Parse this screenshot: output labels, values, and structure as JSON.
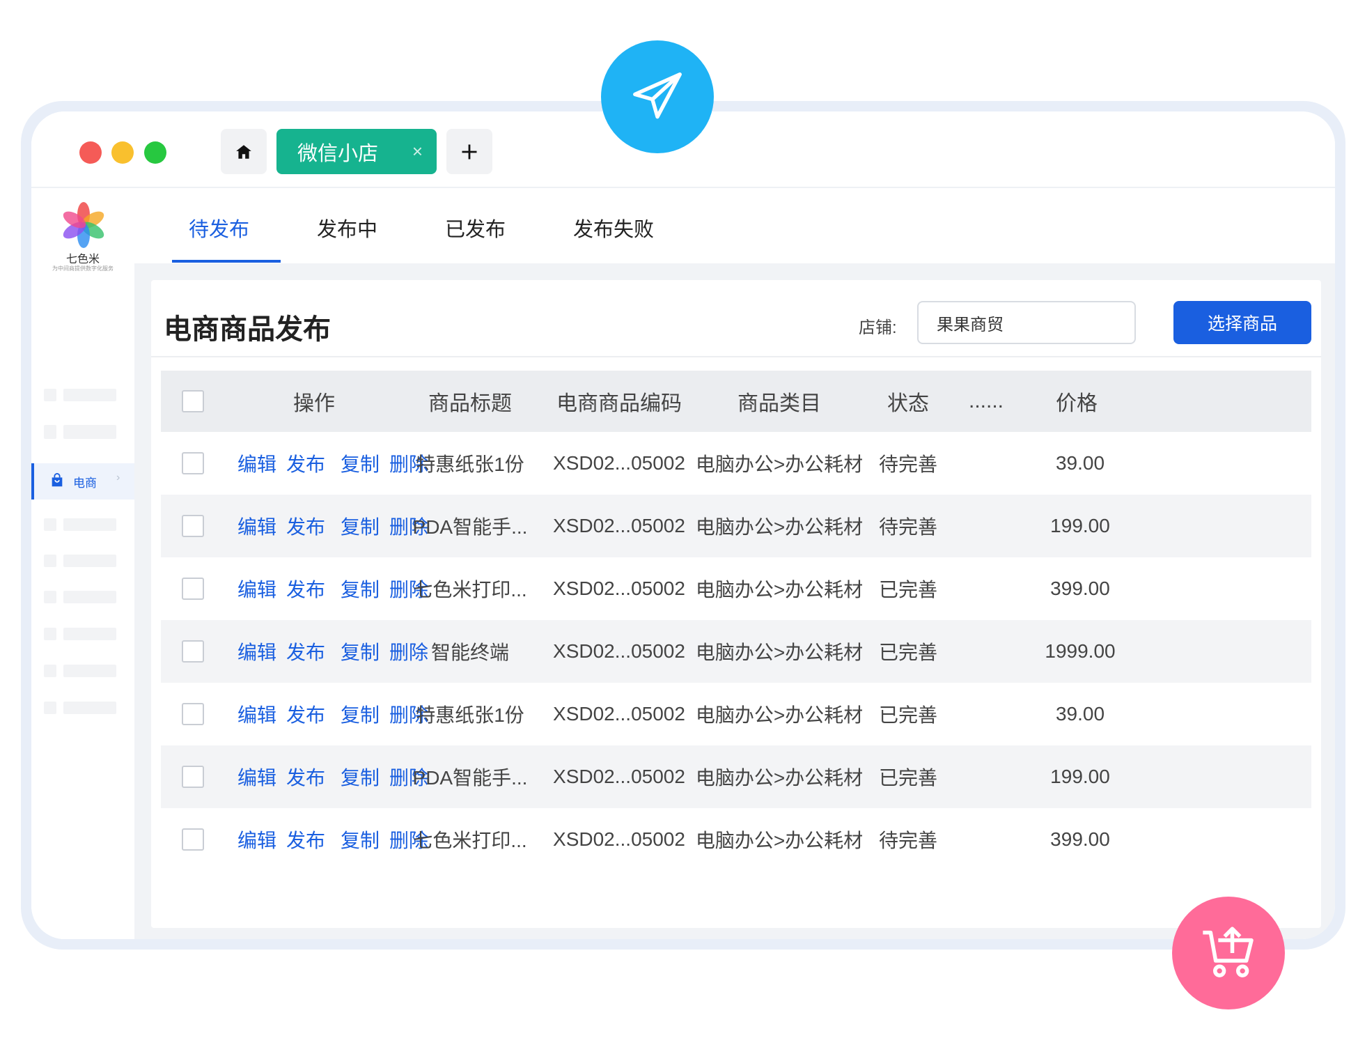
{
  "window": {
    "tabs": {
      "active_label": "微信小店",
      "close_glyph": "×",
      "add_glyph": "+"
    }
  },
  "sidebar": {
    "logo_name": "七色米",
    "logo_tagline": "为中间商提供数字化服务",
    "active_item": {
      "label": "电商",
      "icon": "shopping-bag-icon"
    }
  },
  "status_tabs": [
    {
      "label": "待发布",
      "active": true
    },
    {
      "label": "发布中",
      "active": false
    },
    {
      "label": "已发布",
      "active": false
    },
    {
      "label": "发布失败",
      "active": false
    }
  ],
  "page": {
    "title": "电商商品发布",
    "shop_label": "店铺:",
    "shop_value": "果果商贸",
    "select_button": "选择商品"
  },
  "table": {
    "headers": {
      "ops": "操作",
      "title": "商品标题",
      "code": "电商商品编码",
      "category": "商品类目",
      "status": "状态",
      "more": "......",
      "price": "价格"
    },
    "op_labels": [
      "编辑",
      "发布",
      "复制",
      "删除"
    ],
    "rows": [
      {
        "title": "特惠纸张1份",
        "code": "XSD02...05002",
        "category": "电脑办公>办公耗材",
        "status": "待完善",
        "price": "39.00"
      },
      {
        "title": "PDA智能手...",
        "code": "XSD02...05002",
        "category": "电脑办公>办公耗材",
        "status": "待完善",
        "price": "199.00"
      },
      {
        "title": "七色米打印...",
        "code": "XSD02...05002",
        "category": "电脑办公>办公耗材",
        "status": "已完善",
        "price": "399.00"
      },
      {
        "title": "智能终端",
        "code": "XSD02...05002",
        "category": "电脑办公>办公耗材",
        "status": "已完善",
        "price": "1999.00"
      },
      {
        "title": "特惠纸张1份",
        "code": "XSD02...05002",
        "category": "电脑办公>办公耗材",
        "status": "已完善",
        "price": "39.00"
      },
      {
        "title": "PDA智能手...",
        "code": "XSD02...05002",
        "category": "电脑办公>办公耗材",
        "status": "已完善",
        "price": "199.00"
      },
      {
        "title": "七色米打印...",
        "code": "XSD02...05002",
        "category": "电脑办公>办公耗材",
        "status": "待完善",
        "price": "399.00"
      }
    ]
  },
  "colors": {
    "accent": "#1a5fe0",
    "tab_active": "#16b38f",
    "send_badge": "#1fb3f5",
    "cart_badge": "#ff6b99"
  },
  "icons": {
    "home": "home-icon",
    "send": "paper-plane-icon",
    "cart": "cart-upload-icon"
  }
}
